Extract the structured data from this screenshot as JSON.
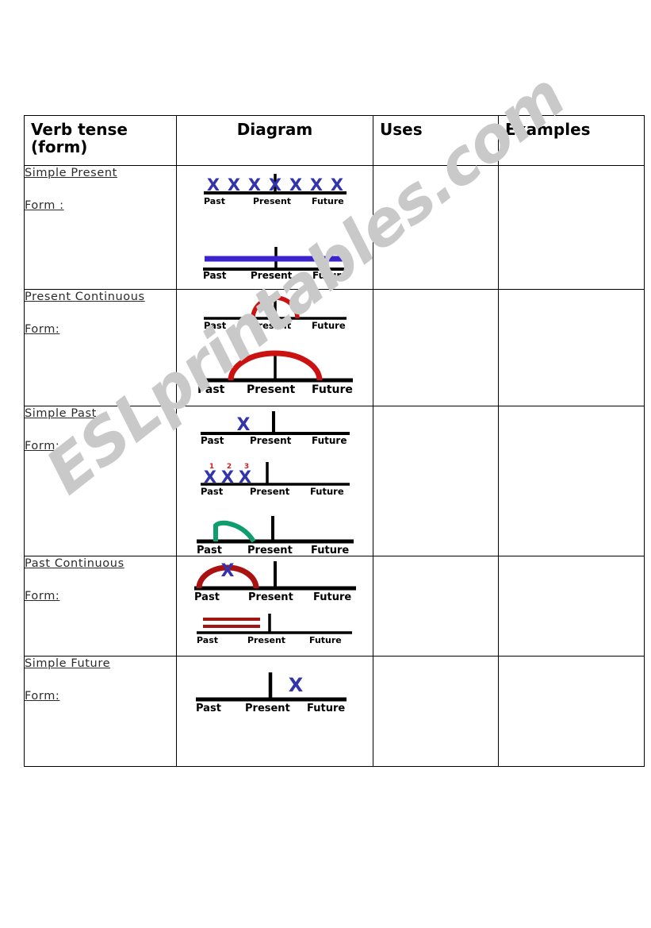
{
  "document": {
    "type": "grammar-worksheet",
    "watermark": "ESLprintables.com"
  },
  "table": {
    "headers": [
      {
        "label": "Verb tense (form)",
        "line1": "Verb tense",
        "line2": "(form)",
        "align": "left"
      },
      {
        "label": "Diagram",
        "align": "center"
      },
      {
        "label": "Uses",
        "align": "left"
      },
      {
        "label": "Examples",
        "align": "left"
      }
    ],
    "rows": [
      {
        "tense": "Simple Present",
        "form_label": "Form :",
        "uses": "",
        "examples": "",
        "diagrams": [
          {
            "id": "simple-present-repeated-x",
            "kind": "timeline-marks",
            "axis_labels": [
              "Past",
              "Present",
              "Future"
            ],
            "marks": {
              "glyph": "X",
              "color": "#3333aa",
              "count": 7
            }
          },
          {
            "id": "simple-present-continuous-line",
            "kind": "timeline-span",
            "axis_labels": [
              "Past",
              "Present",
              "Future"
            ],
            "span": {
              "color": "#3a22cc",
              "from": "past",
              "to": "future"
            }
          }
        ]
      },
      {
        "tense": "Present Continuous",
        "form_label": "Form:",
        "uses": "",
        "examples": "",
        "diagrams": [
          {
            "id": "present-continuous-small-arc",
            "kind": "timeline-arc",
            "axis_labels": [
              "Past",
              "Present",
              "Future"
            ],
            "arc": {
              "color": "#cc1111",
              "center": "present",
              "width": "narrow"
            }
          },
          {
            "id": "present-continuous-wide-arc",
            "kind": "timeline-arc",
            "axis_labels": [
              "Past",
              "Present",
              "Future"
            ],
            "arc": {
              "color": "#cc1111",
              "center": "present",
              "width": "wide"
            }
          }
        ]
      },
      {
        "tense": "Simple Past",
        "form_label": "Form:",
        "uses": "",
        "examples": "",
        "diagrams": [
          {
            "id": "simple-past-single-x",
            "kind": "timeline-marks",
            "axis_labels": [
              "Past",
              "Present",
              "Future"
            ],
            "marks": {
              "glyph": "X",
              "color": "#3333aa",
              "count": 1
            }
          },
          {
            "id": "simple-past-numbered-x",
            "kind": "timeline-marks-numbered",
            "axis_labels": [
              "Past",
              "Present",
              "Future"
            ],
            "marks": {
              "glyph": "X",
              "color": "#3333aa",
              "count": 3
            },
            "numbers": [
              "1",
              "2",
              "3"
            ],
            "number_color": "#cc2222"
          },
          {
            "id": "simple-past-green-arc",
            "kind": "timeline-arc",
            "axis_labels": [
              "Past",
              "Present",
              "Future"
            ],
            "arc": {
              "color": "#0f9d6e",
              "center": "past",
              "width": "quarter"
            }
          }
        ]
      },
      {
        "tense": "Past Continuous",
        "form_label": "Form:",
        "uses": "",
        "examples": "",
        "diagrams": [
          {
            "id": "past-continuous-arc-with-x",
            "kind": "timeline-arc-mark",
            "axis_labels": [
              "Past",
              "Present",
              "Future"
            ],
            "arc": {
              "color": "#aa1111",
              "center": "past",
              "width": "narrow"
            },
            "marks": {
              "glyph": "X",
              "color": "#3333aa",
              "count": 1
            }
          },
          {
            "id": "past-continuous-double-line",
            "kind": "timeline-double-span",
            "axis_labels": [
              "Past",
              "Present",
              "Future"
            ],
            "span": {
              "color": "#a11515",
              "from": "past",
              "to": "present",
              "lines": 2
            }
          }
        ]
      },
      {
        "tense": "Simple Future",
        "form_label": "Form:",
        "uses": "",
        "examples": "",
        "diagrams": [
          {
            "id": "simple-future-x",
            "kind": "timeline-marks",
            "axis_labels": [
              "Past",
              "Present",
              "Future"
            ],
            "marks": {
              "glyph": "X",
              "color": "#3333aa",
              "count": 1
            }
          }
        ]
      }
    ]
  },
  "colors": {
    "mark_blue": "#3333aa",
    "span_blue": "#3a22cc",
    "arc_red": "#cc1111",
    "arc_dark_red": "#a11515",
    "arc_green": "#0f9d6e",
    "number_red": "#cc2222",
    "axis_black": "#000000",
    "watermark_grey": "#c9c9c9"
  }
}
